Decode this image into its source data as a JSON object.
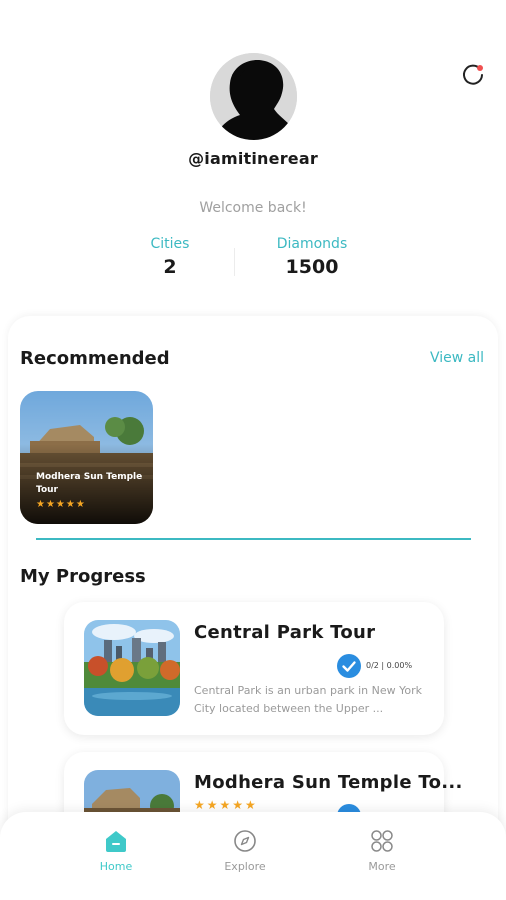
{
  "profile": {
    "username": "@iamitinerear",
    "welcome": "Welcome back!",
    "stats": [
      {
        "label": "Cities",
        "value": "2"
      },
      {
        "label": "Diamonds",
        "value": "1500"
      }
    ]
  },
  "icons": {
    "refresh": "refresh-icon",
    "avatar": "user-silhouette"
  },
  "recommended": {
    "title": "Recommended",
    "view_all": "View all",
    "items": [
      {
        "title": "Modhera Sun Temple Tour",
        "stars": "★★★★★",
        "rating": 5
      }
    ]
  },
  "progress": {
    "title": "My Progress",
    "items": [
      {
        "title": "Central Park Tour",
        "stats": "0/2 | 0.00%",
        "description": "Central Park is an urban park in New York City located between the Upper ..."
      },
      {
        "title": "Modhera Sun Temple To...",
        "stars": "★★★★★",
        "rating": 5
      }
    ]
  },
  "nav": [
    {
      "label": "Home",
      "active": true
    },
    {
      "label": "Explore",
      "active": false
    },
    {
      "label": "More",
      "active": false
    }
  ],
  "colors": {
    "accent": "#3cb9c2",
    "check": "#2a8de0",
    "star": "#f5a623"
  }
}
